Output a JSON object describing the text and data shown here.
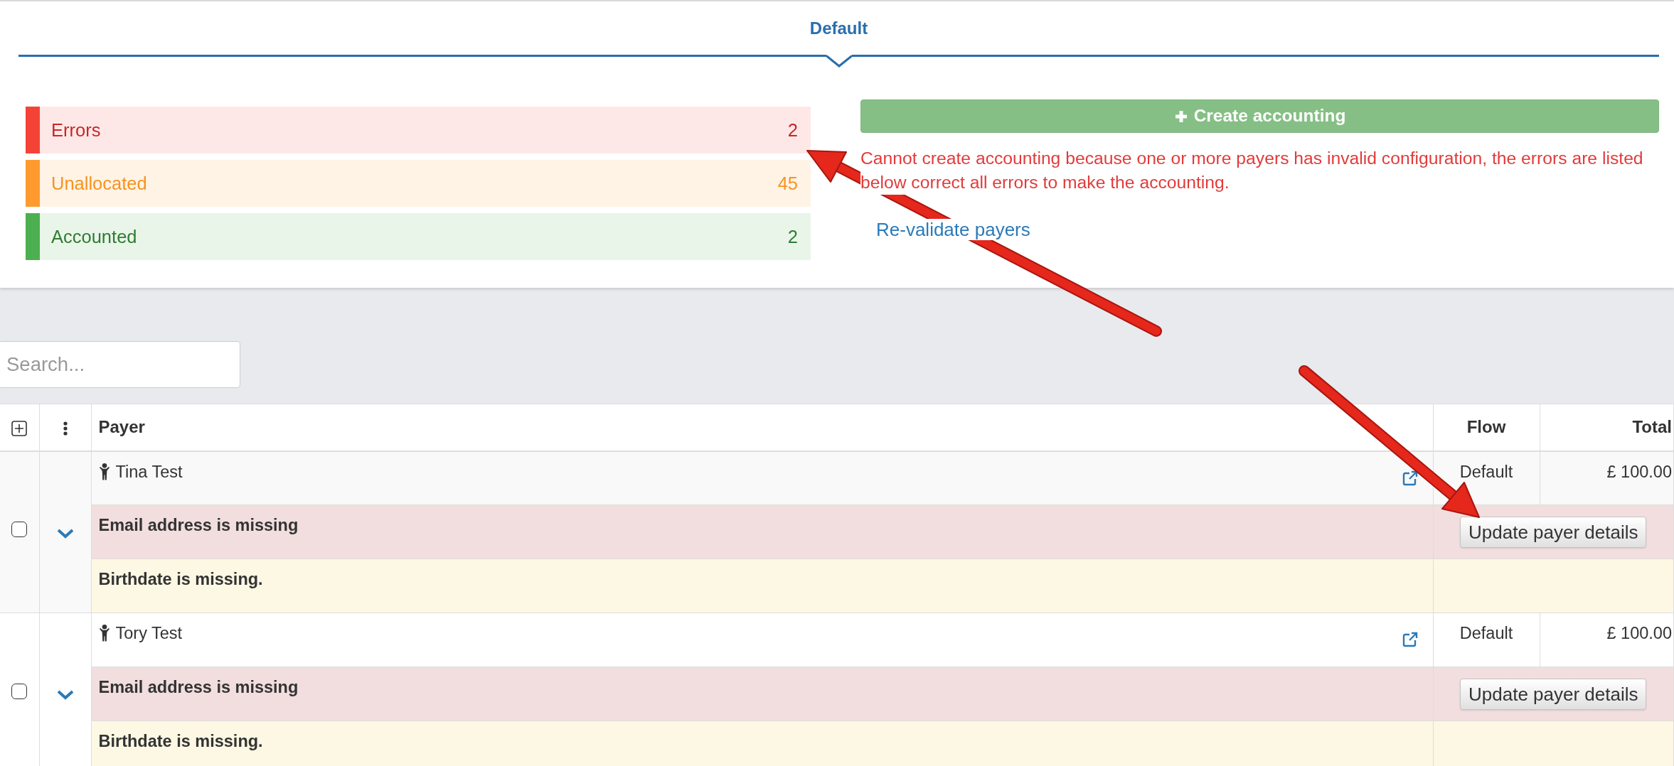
{
  "tabs": [
    {
      "label": "Default",
      "selected": true
    }
  ],
  "status_summary": [
    {
      "kind": "error",
      "label": "Errors",
      "count": "2",
      "color": "#f44336"
    },
    {
      "kind": "warning",
      "label": "Unallocated",
      "count": "45",
      "color": "#ff9a2e"
    },
    {
      "kind": "success",
      "label": "Accounted",
      "count": "2",
      "color": "#4caf50"
    }
  ],
  "create_button": {
    "label": "Create accounting",
    "disabled": true
  },
  "error_message": "Cannot create accounting because one or more payers has invalid configuration, the errors are listed below correct all errors to make the accounting.",
  "revalidate_link": "Re-validate payers",
  "search": {
    "placeholder": "Search..."
  },
  "table": {
    "columns": [
      "Payer",
      "Flow",
      "Total"
    ],
    "rows": [
      {
        "checked": false,
        "expanded": true,
        "payer": "Tina Test",
        "flow": "Default",
        "total": "£ 100.00",
        "issues": [
          {
            "kind": "error",
            "message": "Email address is missing",
            "action": "Update payer details"
          },
          {
            "kind": "warning",
            "message": "Birthdate is missing."
          }
        ]
      },
      {
        "checked": false,
        "expanded": true,
        "payer": "Tory Test",
        "flow": "Default",
        "total": "£ 100.00",
        "issues": [
          {
            "kind": "error",
            "message": "Email address is missing",
            "action": "Update payer details"
          },
          {
            "kind": "warning",
            "message": "Birthdate is missing."
          }
        ]
      }
    ]
  }
}
